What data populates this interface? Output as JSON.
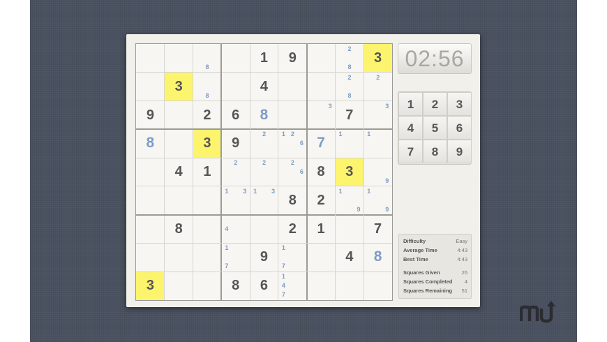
{
  "timer": "02:56",
  "numpad": [
    "1",
    "2",
    "3",
    "4",
    "5",
    "6",
    "7",
    "8",
    "9"
  ],
  "stats": [
    {
      "label": "Difficulty",
      "value": "Easy"
    },
    {
      "label": "Average Time",
      "value": "4:43"
    },
    {
      "label": "Best Time",
      "value": "4:43"
    },
    {
      "label": "Squares Given",
      "value": "26"
    },
    {
      "label": "Squares Completed",
      "value": "4"
    },
    {
      "label": "Squares Remaining",
      "value": "51"
    }
  ],
  "grid": [
    [
      {
        "n": [
          8
        ]
      },
      {
        "g": "1"
      },
      {
        "g": "9"
      },
      {},
      {
        "n": [
          2,
          8
        ]
      },
      {
        "g": "3",
        "hl": true
      }
    ],
    [],
    [],
    [],
    [],
    [],
    [],
    [],
    []
  ],
  "cells": [
    {
      "r": 0,
      "c": 2,
      "n": [
        8
      ]
    },
    {
      "r": 0,
      "c": 4,
      "g": "1"
    },
    {
      "r": 0,
      "c": 5,
      "g": "9"
    },
    {
      "r": 0,
      "c": 7,
      "n": [
        2,
        8
      ]
    },
    {
      "r": 0,
      "c": 8,
      "g": "3",
      "hl": true
    },
    {
      "r": 1,
      "c": 1,
      "g": "3",
      "hl": true
    },
    {
      "r": 1,
      "c": 2,
      "n": [
        8
      ]
    },
    {
      "r": 1,
      "c": 4,
      "g": "4"
    },
    {
      "r": 1,
      "c": 7,
      "n": [
        2,
        8
      ]
    },
    {
      "r": 1,
      "c": 8,
      "n": [
        2
      ]
    },
    {
      "r": 2,
      "c": 0,
      "g": "9"
    },
    {
      "r": 2,
      "c": 2,
      "g": "2"
    },
    {
      "r": 2,
      "c": 3,
      "g": "6"
    },
    {
      "r": 2,
      "c": 4,
      "e": "8"
    },
    {
      "r": 2,
      "c": 6,
      "n": [
        3
      ]
    },
    {
      "r": 2,
      "c": 7,
      "g": "7"
    },
    {
      "r": 2,
      "c": 8,
      "n": [
        3
      ]
    },
    {
      "r": 3,
      "c": 0,
      "e": "8"
    },
    {
      "r": 3,
      "c": 2,
      "g": "3",
      "hl": true
    },
    {
      "r": 3,
      "c": 3,
      "g": "9"
    },
    {
      "r": 3,
      "c": 4,
      "n": [
        2
      ]
    },
    {
      "r": 3,
      "c": 5,
      "n": [
        1,
        2,
        6
      ]
    },
    {
      "r": 3,
      "c": 6,
      "e": "7"
    },
    {
      "r": 3,
      "c": 7,
      "n": [
        1
      ]
    },
    {
      "r": 3,
      "c": 8,
      "n": [
        1
      ]
    },
    {
      "r": 4,
      "c": 1,
      "g": "4"
    },
    {
      "r": 4,
      "c": 2,
      "g": "1"
    },
    {
      "r": 4,
      "c": 3,
      "n": [
        2
      ]
    },
    {
      "r": 4,
      "c": 4,
      "n": [
        2
      ]
    },
    {
      "r": 4,
      "c": 5,
      "n": [
        2,
        6
      ]
    },
    {
      "r": 4,
      "c": 6,
      "g": "8"
    },
    {
      "r": 4,
      "c": 7,
      "g": "3",
      "hl": true
    },
    {
      "r": 4,
      "c": 8,
      "n": [
        9
      ]
    },
    {
      "r": 5,
      "c": 3,
      "n": [
        1,
        3
      ]
    },
    {
      "r": 5,
      "c": 4,
      "n": [
        1,
        3
      ]
    },
    {
      "r": 5,
      "c": 5,
      "g": "8"
    },
    {
      "r": 5,
      "c": 6,
      "g": "2"
    },
    {
      "r": 5,
      "c": 7,
      "n": [
        1,
        9
      ]
    },
    {
      "r": 5,
      "c": 8,
      "n": [
        1,
        9
      ]
    },
    {
      "r": 6,
      "c": 1,
      "g": "8"
    },
    {
      "r": 6,
      "c": 3,
      "n": [
        4
      ]
    },
    {
      "r": 6,
      "c": 5,
      "g": "2"
    },
    {
      "r": 6,
      "c": 6,
      "g": "1"
    },
    {
      "r": 6,
      "c": 8,
      "g": "7"
    },
    {
      "r": 7,
      "c": 3,
      "n": [
        1,
        7
      ]
    },
    {
      "r": 7,
      "c": 4,
      "g": "9"
    },
    {
      "r": 7,
      "c": 5,
      "n": [
        1,
        7
      ]
    },
    {
      "r": 7,
      "c": 7,
      "g": "4"
    },
    {
      "r": 7,
      "c": 8,
      "e": "8"
    },
    {
      "r": 8,
      "c": 0,
      "g": "3",
      "hl": true
    },
    {
      "r": 8,
      "c": 3,
      "g": "8"
    },
    {
      "r": 8,
      "c": 4,
      "g": "6"
    },
    {
      "r": 8,
      "c": 5,
      "n": [
        1,
        4,
        7
      ]
    }
  ],
  "colors": {
    "highlight": "#fdf46d",
    "given": "#555555",
    "entered": "#7e9cc6",
    "background": "#4a5160"
  },
  "logo_icon": "mu-logo-icon"
}
